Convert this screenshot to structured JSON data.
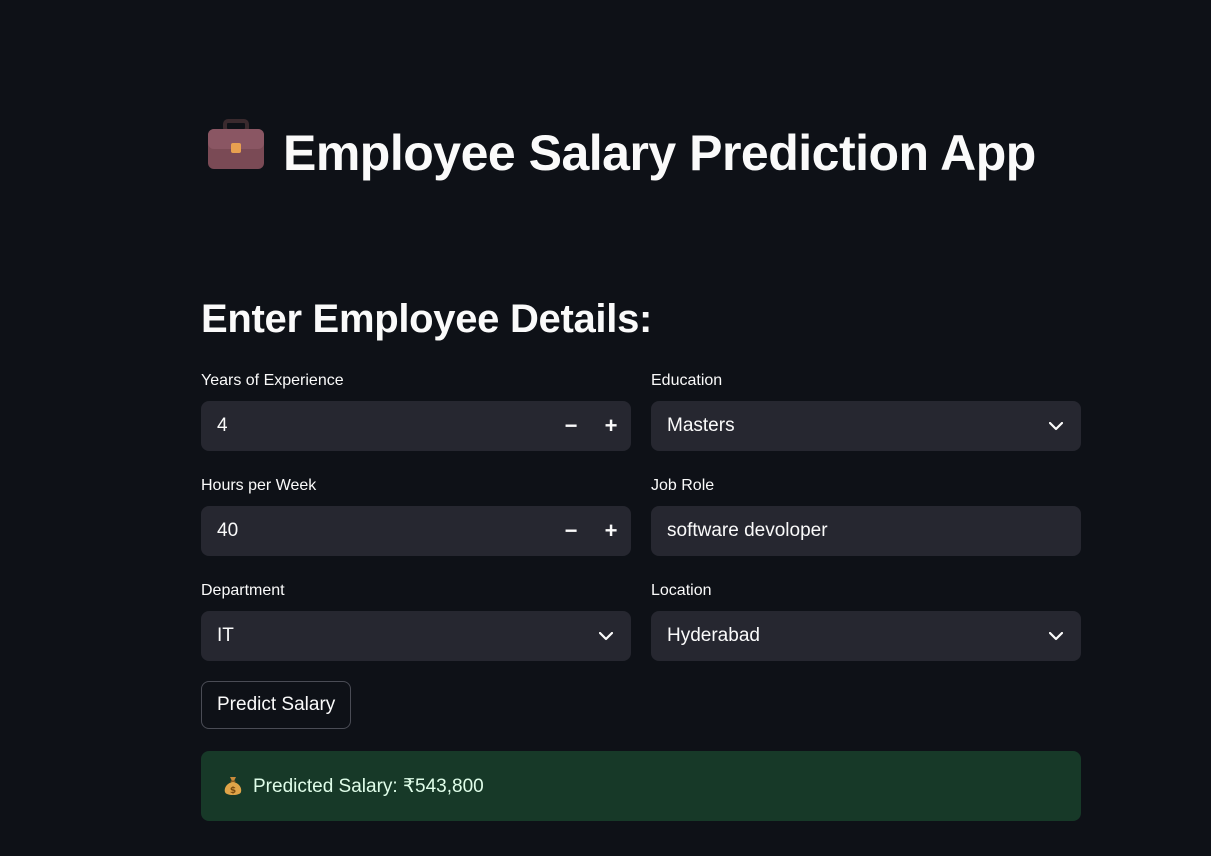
{
  "app": {
    "title": "Employee Salary Prediction App",
    "title_icon": "briefcase-icon"
  },
  "form": {
    "heading": "Enter Employee Details:",
    "experience": {
      "label": "Years of Experience",
      "value": "4"
    },
    "education": {
      "label": "Education",
      "value": "Masters"
    },
    "hours": {
      "label": "Hours per Week",
      "value": "40"
    },
    "job_role": {
      "label": "Job Role",
      "value": "software devoloper"
    },
    "department": {
      "label": "Department",
      "value": "IT"
    },
    "location": {
      "label": "Location",
      "value": "Hyderabad"
    },
    "stepper_minus": "−",
    "stepper_plus": "+",
    "predict_label": "Predict Salary"
  },
  "result": {
    "icon": "money-bag-icon",
    "text": "Predicted Salary: ₹543,800",
    "color": "#173928"
  },
  "colors": {
    "background": "#0e1117",
    "input_bg": "#262730",
    "text": "#fafafa"
  }
}
